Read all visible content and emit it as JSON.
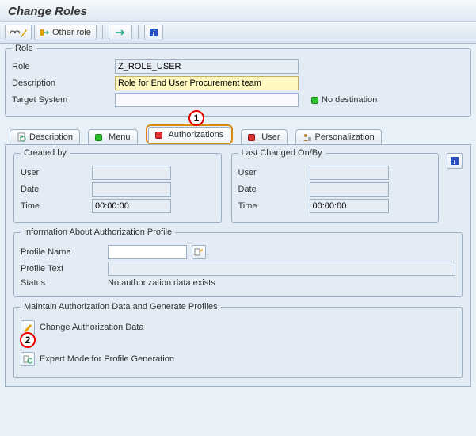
{
  "title": "Change Roles",
  "toolbar": {
    "other_role_label": "Other role"
  },
  "role_group": {
    "title": "Role",
    "role_label": "Role",
    "role_value": "Z_ROLE_USER",
    "desc_label": "Description",
    "desc_value": "Role for End User Procurement team",
    "target_label": "Target System",
    "target_value": "",
    "no_dest_label": "No destination"
  },
  "tabs": {
    "description": "Description",
    "menu": "Menu",
    "authorizations": "Authorizations",
    "user": "User",
    "personalization": "Personalization"
  },
  "callouts": {
    "one": "1",
    "two": "2"
  },
  "created": {
    "title": "Created by",
    "user_label": "User",
    "user_value": "",
    "date_label": "Date",
    "date_value": "",
    "time_label": "Time",
    "time_value": "00:00:00"
  },
  "changed": {
    "title": "Last Changed On/By",
    "user_label": "User",
    "user_value": "",
    "date_label": "Date",
    "date_value": "",
    "time_label": "Time",
    "time_value": "00:00:00"
  },
  "profile_info": {
    "title": "Information About Authorization Profile",
    "name_label": "Profile Name",
    "name_value": "",
    "text_label": "Profile Text",
    "text_value": "",
    "status_label": "Status",
    "status_value": "No authorization data exists"
  },
  "maintain": {
    "title": "Maintain Authorization Data and Generate Profiles",
    "change_label": "Change Authorization Data",
    "expert_label": "Expert Mode for Profile Generation"
  }
}
